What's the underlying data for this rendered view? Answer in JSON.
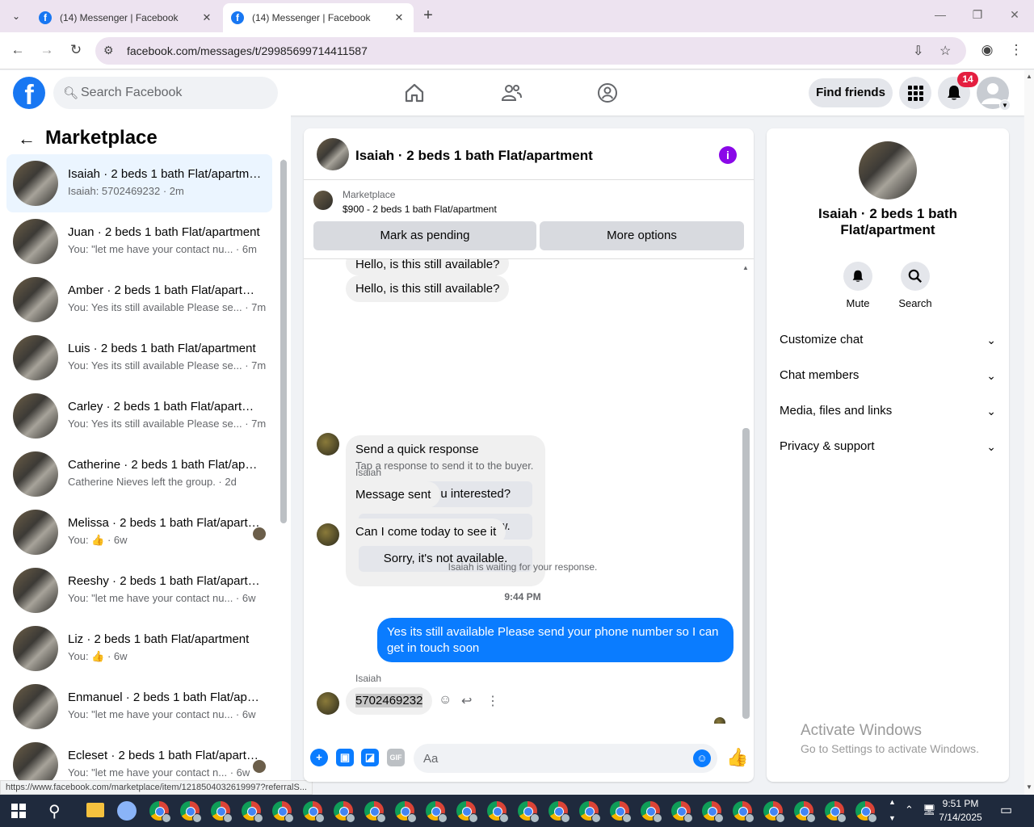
{
  "browser": {
    "tabs": [
      {
        "title": "(14) Messenger | Facebook",
        "active": false
      },
      {
        "title": "(14) Messenger | Facebook",
        "active": true
      }
    ],
    "url": "facebook.com/messages/t/29985699714411587",
    "status_url": "https://www.facebook.com/marketplace/item/1218504032619997?referralS..."
  },
  "header": {
    "search_placeholder": "Search Facebook",
    "find_friends": "Find friends",
    "notification_count": "14"
  },
  "sidebar": {
    "title": "Marketplace",
    "conversations": [
      {
        "name": "Isaiah · 2 beds 1 bath Flat/apartment",
        "preview": "Isaiah: 5702469232 · 2m",
        "selected": true
      },
      {
        "name": "Juan · 2 beds 1 bath Flat/apartment",
        "preview": "You: \"let me have your contact nu... · 6m"
      },
      {
        "name": "Amber · 2 beds 1 bath Flat/apartment",
        "preview": "You: Yes its still available Please se... · 7m"
      },
      {
        "name": "Luis · 2 beds 1 bath Flat/apartment",
        "preview": "You: Yes its still available Please se... · 7m"
      },
      {
        "name": "Carley · 2 beds 1 bath Flat/apartment",
        "preview": "You: Yes its still available Please se... · 7m"
      },
      {
        "name": "Catherine · 2 beds 1 bath Flat/apartment",
        "preview": "Catherine Nieves left the group. · 2d"
      },
      {
        "name": "Melissa · 2 beds 1 bath Flat/apartment",
        "preview": "You: 👍 · 6w"
      },
      {
        "name": "Reeshy · 2 beds 1 bath Flat/apartment",
        "preview": "You: \"let me have your contact nu... · 6w"
      },
      {
        "name": "Liz · 2 beds 1 bath Flat/apartment",
        "preview": "You: 👍 · 6w"
      },
      {
        "name": "Enmanuel · 2 beds 1 bath Flat/apartment",
        "preview": "You: \"let me have your contact nu... · 6w"
      },
      {
        "name": "Ecleset · 2 beds 1 bath Flat/apartment",
        "preview": "You: \"let me have your contact n... · 6w"
      }
    ]
  },
  "chat": {
    "title": "Isaiah · 2 beds 1 bath Flat/apartment",
    "listing_source": "Marketplace",
    "listing_price": "$900 - 2 beds 1 bath Flat/apartment",
    "mark_pending": "Mark as pending",
    "more_options": "More options",
    "msg_hello_cut": "Hello, is this still available?",
    "msg_hello": "Hello, is this still available?",
    "quick_title": "Send a quick response",
    "quick_sub": "Tap a response to send it to the buyer.",
    "quick_options": [
      "Yes, are you interested?",
      "In talks. I'll let you know.",
      "Sorry, it's not available."
    ],
    "sender1": "Isaiah",
    "msg_sent": "Message sent",
    "msg_come": "Can I come today to see it",
    "waiting": "Isaiah is waiting for your response.",
    "time": "9:44 PM",
    "outgoing": "Yes its still available Please send your phone number so I can get in touch soon",
    "sender2": "Isaiah",
    "phone": "5702469232",
    "composer_placeholder": "Aa"
  },
  "details": {
    "name": "Isaiah · 2 beds 1 bath Flat/apartment",
    "mute": "Mute",
    "search": "Search",
    "sections": [
      "Customize chat",
      "Chat members",
      "Media, files and links",
      "Privacy & support"
    ]
  },
  "watermark": {
    "line1": "Activate Windows",
    "line2": "Go to Settings to activate Windows."
  },
  "taskbar": {
    "time": "9:51 PM",
    "date": "7/14/2025"
  }
}
